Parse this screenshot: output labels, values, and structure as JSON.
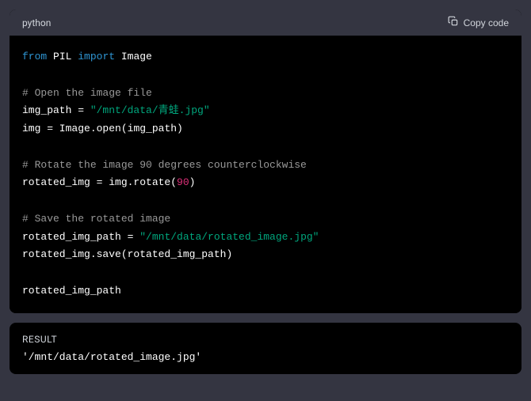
{
  "code_block": {
    "language": "python",
    "copy_label": "Copy code",
    "tokens": [
      [
        {
          "t": "from ",
          "c": "kw-from"
        },
        {
          "t": "PIL ",
          "c": "ident"
        },
        {
          "t": "import ",
          "c": "kw-import"
        },
        {
          "t": "Image",
          "c": "ident"
        }
      ],
      [],
      [
        {
          "t": "# Open the image file",
          "c": "comment"
        }
      ],
      [
        {
          "t": "img_path = ",
          "c": "ident"
        },
        {
          "t": "\"/mnt/data/青蛙.jpg\"",
          "c": "string"
        }
      ],
      [
        {
          "t": "img = Image.",
          "c": "ident"
        },
        {
          "t": "open",
          "c": "func"
        },
        {
          "t": "(img_path)",
          "c": "ident"
        }
      ],
      [],
      [
        {
          "t": "# Rotate the image 90 degrees counterclockwise",
          "c": "comment"
        }
      ],
      [
        {
          "t": "rotated_img = img.rotate(",
          "c": "ident"
        },
        {
          "t": "90",
          "c": "number"
        },
        {
          "t": ")",
          "c": "ident"
        }
      ],
      [],
      [
        {
          "t": "# Save the rotated image",
          "c": "comment"
        }
      ],
      [
        {
          "t": "rotated_img_path = ",
          "c": "ident"
        },
        {
          "t": "\"/mnt/data/rotated_image.jpg\"",
          "c": "string"
        }
      ],
      [
        {
          "t": "rotated_img.save(rotated_img_path)",
          "c": "ident"
        }
      ],
      [],
      [
        {
          "t": "rotated_img_path",
          "c": "ident"
        }
      ]
    ]
  },
  "result_block": {
    "label": "RESULT",
    "output": "'/mnt/data/rotated_image.jpg'"
  }
}
